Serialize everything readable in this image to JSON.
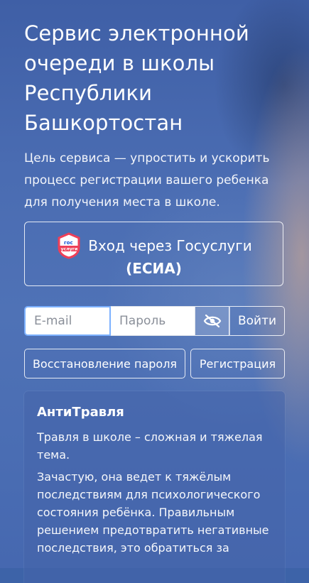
{
  "header": {
    "title": "Сервис электронной очереди в школы Республики Башкортостан",
    "subtitle": "Цель сервиса — упростить и ускорить процесс регистрации вашего ребенка для получения места в школе."
  },
  "gosuslugi": {
    "logo_text_top": "гос",
    "logo_text_bottom": "услуги",
    "label": "Вход через Госуслуги",
    "label_secondary": "(ЕСИА)"
  },
  "login": {
    "email_placeholder": "E-mail",
    "password_placeholder": "Пароль",
    "toggle_icon": "eye-slash-icon",
    "submit_label": "Войти"
  },
  "actions": {
    "recovery_label": "Восстановление пароля",
    "register_label": "Регистрация"
  },
  "info_card": {
    "title": "АнтиТравля",
    "paragraph1": "Травля в школе – сложная и тяжелая тема.",
    "paragraph2": "Зачастую, она ведет к тяжёлым последствиям для психологического состояния ребёнка. Правильным решением предотвратить негативные последствия, это обратиться за"
  },
  "colors": {
    "background": "#4a6cb2",
    "input_focus_border": "#7cb1ff",
    "gos_logo_red": "#ee3f58",
    "gos_logo_blue": "#0d4cd3"
  }
}
